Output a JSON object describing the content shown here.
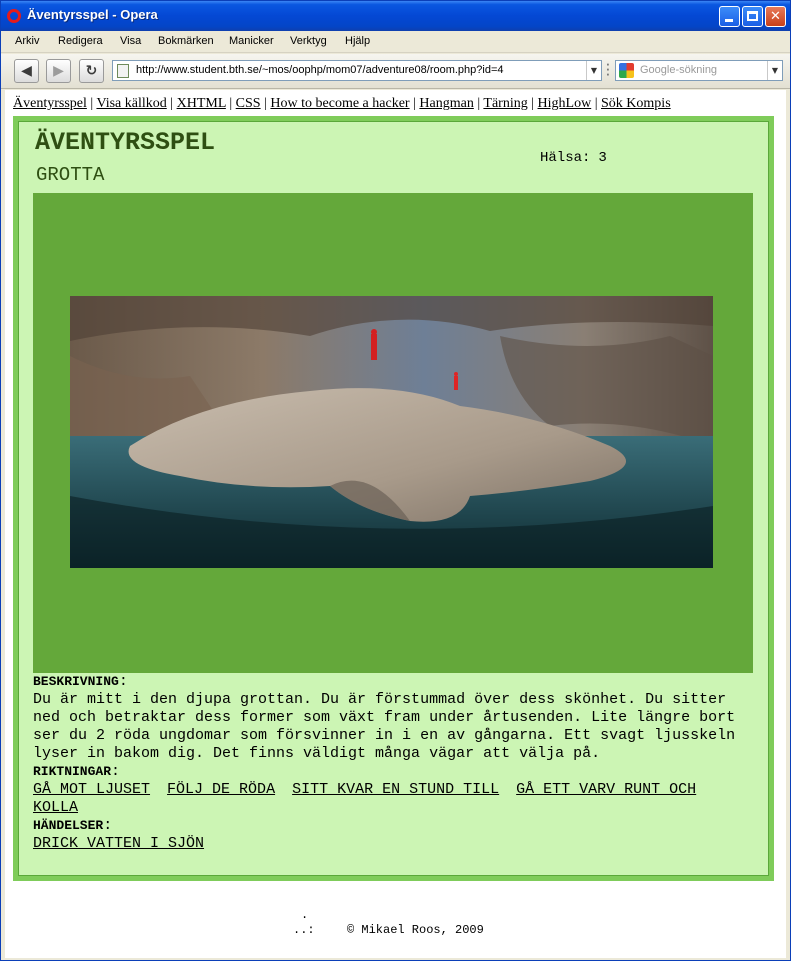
{
  "window": {
    "title": "Äventyrsspel - Opera",
    "minimize_glyph": "",
    "close_glyph": "✕"
  },
  "menubar": {
    "items": [
      "Arkiv",
      "Redigera",
      "Visa",
      "Bokmärken",
      "Manicker",
      "Verktyg",
      "Hjälp"
    ]
  },
  "toolbar": {
    "back_glyph": "◀",
    "forward_glyph": "▶",
    "reload_glyph": "↻",
    "address": "http://www.student.bth.se/~mos/oophp/mom07/adventure08/room.php?id=4",
    "search_placeholder": "Google-sökning"
  },
  "topnav": {
    "links": [
      "Äventyrsspel",
      "Visa källkod",
      "XHTML",
      "CSS",
      "How to become a hacker",
      "Hangman",
      "Tärning",
      "HighLow",
      "Sök Kompis"
    ],
    "separator": "|"
  },
  "game": {
    "title": "ÄVENTYRSSPEL",
    "room": "GROTTA",
    "health_label": "Hälsa:",
    "health_value": "3",
    "description_header": "BESKRIVNING",
    "description": "Du är mitt i den djupa grottan. Du är förstummad över dess skönhet. Du sitter ned och betraktar dess former som växt fram under årtusenden. Lite längre bort ser du 2 röda ungdomar som försvinner in i en av gångarna. Ett svagt ljusskeln lyser in bakom dig. Det finns väldigt många vägar att välja på.",
    "directions_header": "RIKTNINGAR",
    "directions": [
      "GÅ MOT LJUSET",
      "FÖLJ DE RÖDA",
      "SITT KVAR EN STUND TILL",
      "GÅ ETT VARV RUNT OCH KOLLA"
    ],
    "events_header": "HÄNDELSER",
    "events": [
      "DRICK VATTEN I SJÖN"
    ],
    "colon": ":"
  },
  "footer": {
    "dot1": ".",
    "dot2": "..:",
    "copyright": "© Mikael Roos, 2009"
  },
  "colors": {
    "panel_bg": "#ccf5b4",
    "panel_border": "#7fcc5a",
    "image_bg": "#64a83a",
    "title_color": "#2e4f12"
  }
}
